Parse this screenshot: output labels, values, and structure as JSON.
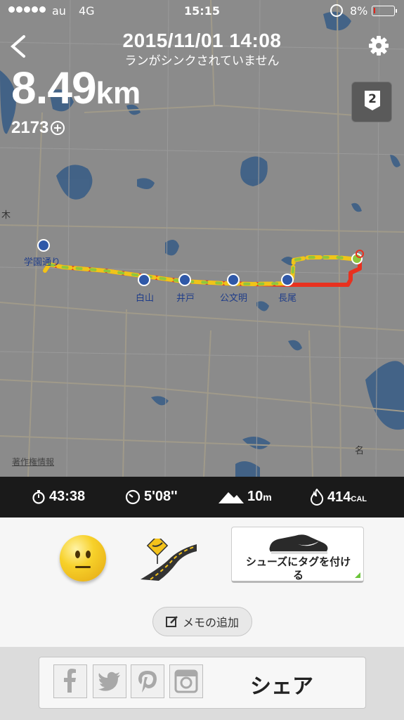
{
  "status_bar": {
    "carrier": "au",
    "network": "4G",
    "time": "15:15",
    "battery_percent": "8%",
    "battery_level": 0.08
  },
  "header": {
    "date": "2015/11/01  14:08",
    "sync_message": "ランがシンクされていません",
    "distance_value": "8.49",
    "distance_unit": "km",
    "fuel": "2173",
    "badge": "2",
    "back_icon": "chevron-left-icon",
    "settings_icon": "gear-icon"
  },
  "map": {
    "labels": {
      "gakuen": "学園通り",
      "hakusan": "白山",
      "ido": "井戸",
      "kumonmyo": "公文明",
      "nagao": "長尾",
      "ki": "木",
      "na": "名"
    },
    "copyright": "著作権情報",
    "colors": {
      "route_slow": "#e8311f",
      "route_mid": "#f0c419",
      "route_fast": "#8ec63f",
      "water": "#3b5e86"
    }
  },
  "stats": {
    "duration": "43:38",
    "pace": "5'08''",
    "elevation_value": "10",
    "elevation_unit": "m",
    "calories_value": "414",
    "calories_unit": "CAL"
  },
  "feedback": {
    "mood_icon": "neutral-face-icon",
    "terrain_icon": "road-icon",
    "shoe_label": "シューズにタグを付ける",
    "memo_label": "メモの追加"
  },
  "share": {
    "label": "シェア",
    "services": [
      "facebook-icon",
      "twitter-icon",
      "pinterest-icon",
      "instagram-icon"
    ]
  }
}
